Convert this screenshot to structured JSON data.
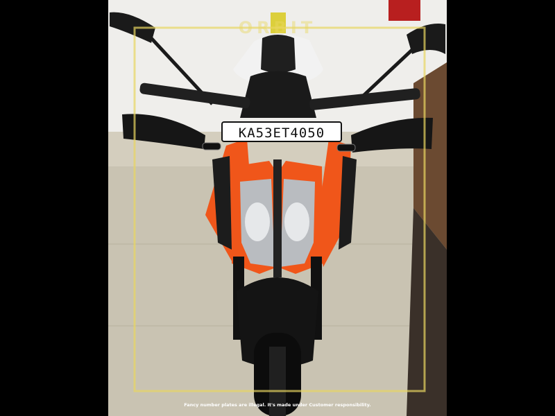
{
  "photo": {
    "subject": "orange and black naked motorcycle, front view, parked indoors",
    "number_plate": "KA53ET4050",
    "watermark_logo": "ORBIT",
    "disclaimer": "Fancy number plates are illegal. It's made under Customer responsibility.",
    "colors": {
      "wall": "#ecebe8",
      "floor": "#c9c3b2",
      "orange": "#f0561a",
      "black": "#1b1b1b",
      "frame_yellow": "#e8d661",
      "wood": "#6b4a31"
    }
  }
}
